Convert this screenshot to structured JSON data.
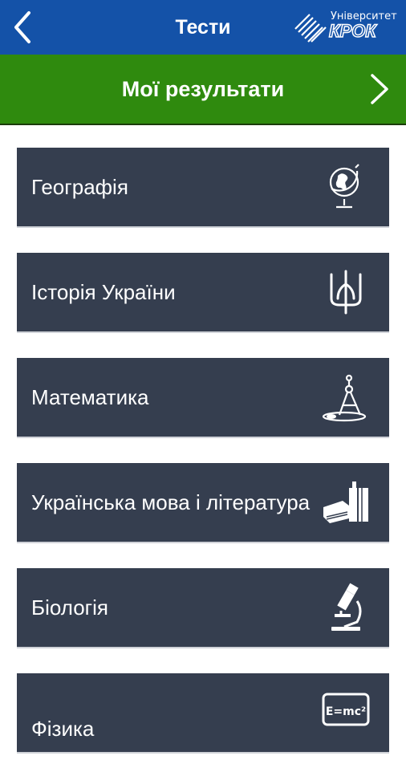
{
  "header": {
    "title": "Тести",
    "back_icon": "chevron-left-icon"
  },
  "logo": {
    "line1": "Університет",
    "line2": "КРОК"
  },
  "results": {
    "label": "Мої результати",
    "icon": "chevron-right-icon"
  },
  "subjects": [
    {
      "label": "Географія",
      "icon": "globe-icon"
    },
    {
      "label": "Історія України",
      "icon": "trident-icon"
    },
    {
      "label": "Математика",
      "icon": "compass-icon"
    },
    {
      "label": "Українська мова і література",
      "icon": "books-icon"
    },
    {
      "label": "Біологія",
      "icon": "microscope-icon"
    },
    {
      "label": "Фізика",
      "icon": "formula-icon",
      "icon_text": "E=mc²"
    }
  ],
  "colors": {
    "header": "#1452a8",
    "results": "#2f8a0e",
    "item": "#353e4f"
  }
}
